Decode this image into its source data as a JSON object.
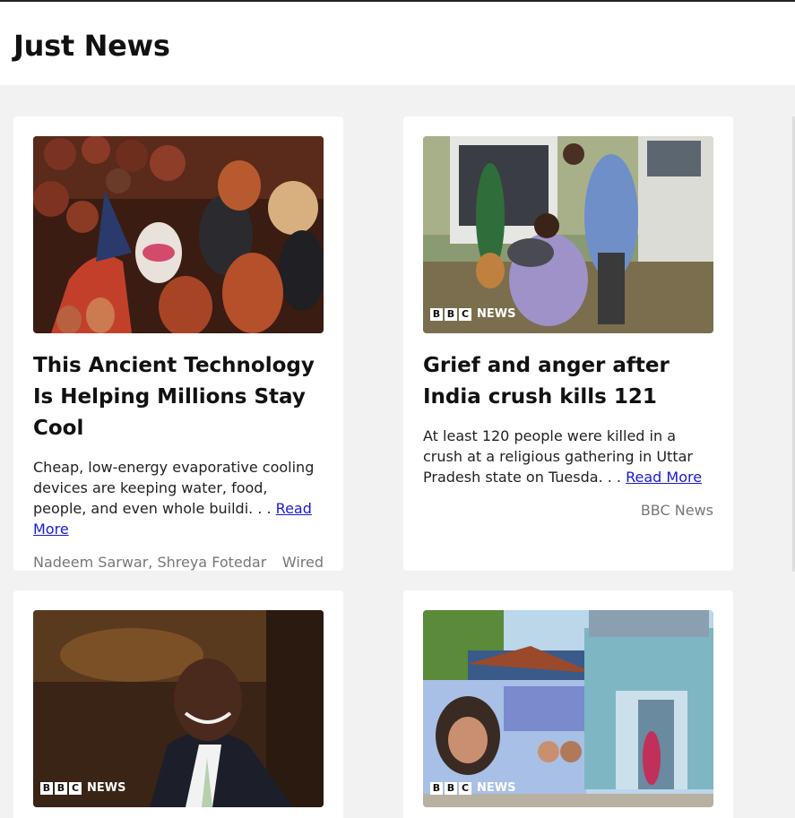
{
  "header": {
    "title": "Just News"
  },
  "cards": [
    {
      "image_icon": "clay-pots-image",
      "title": "This Ancient Technology Is Helping Millions Stay Cool",
      "desc": "Cheap, low-energy evaporative cooling devices are keeping water, food, people, and even whole buildi. . . ",
      "read_more": "Read More",
      "author": "Nadeem Sarwar, Shreya Fotedar",
      "source": "Wired"
    },
    {
      "image_icon": "grieving-man-image",
      "badge": [
        "B",
        "B",
        "C",
        "NEWS"
      ],
      "title": "Grief and anger after India crush kills 121",
      "desc": "At least 120 people were killed in a crush at a religious gathering in Uttar Pradesh state on Tuesda. . . ",
      "read_more": "Read More",
      "source": "BBC News"
    },
    {
      "image_icon": "politician-portrait-image",
      "badge": [
        "B",
        "B",
        "C",
        "NEWS"
      ]
    },
    {
      "image_icon": "temple-banner-image",
      "badge": [
        "B",
        "B",
        "C",
        "NEWS"
      ]
    }
  ]
}
